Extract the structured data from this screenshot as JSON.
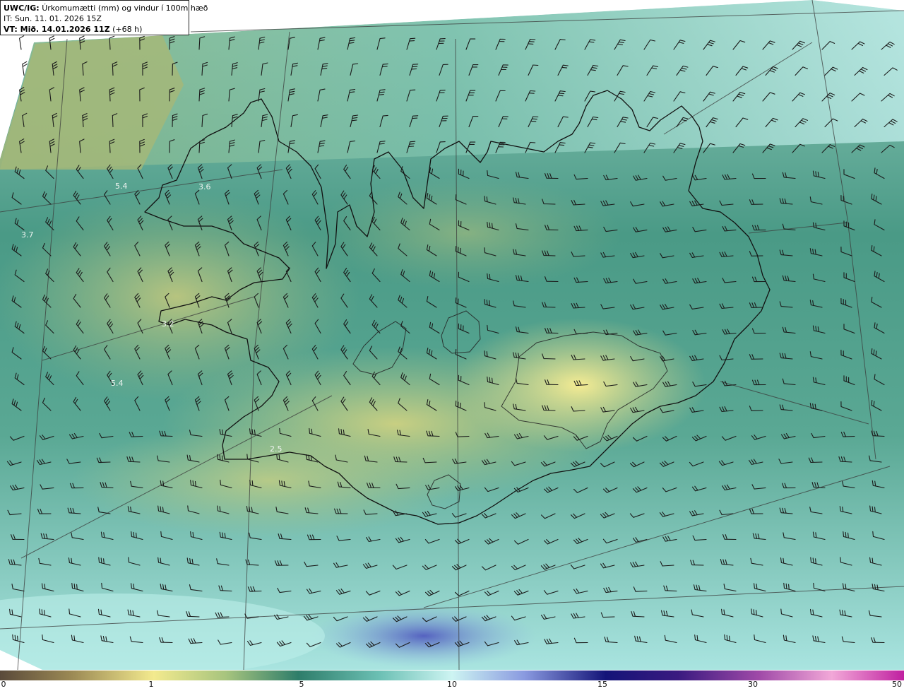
{
  "header": {
    "model_prefix": "UWC/IG:",
    "title": "Úrkomumætti (mm) og vindur í 100m hæð",
    "init_time": "IT: Sun. 11. 01. 2026 15Z",
    "valid_prefix": "VT: Mið. 14.01.2026 11Z",
    "valid_suffix": "(+68 h)"
  },
  "map_labels": [
    {
      "id": "label-1",
      "text": "5.4"
    },
    {
      "id": "label-2",
      "text": "3.6"
    },
    {
      "id": "label-3",
      "text": "3.7"
    },
    {
      "id": "label-4",
      "text": "3.2"
    },
    {
      "id": "label-5",
      "text": "5.4"
    },
    {
      "id": "label-6",
      "text": "2.5"
    }
  ],
  "colorbar": {
    "ticks": [
      "0",
      "1",
      "5",
      "10",
      "15",
      "30",
      "50"
    ],
    "colors": [
      "#5a4a3a",
      "#b8a15a",
      "#f3ea8e",
      "#8fbf86",
      "#2e7d6a",
      "#6cc0b4",
      "#cdf4f2",
      "#6a7cd0",
      "#141478",
      "#6a1a8a",
      "#f2a8d8",
      "#c020a0"
    ]
  }
}
